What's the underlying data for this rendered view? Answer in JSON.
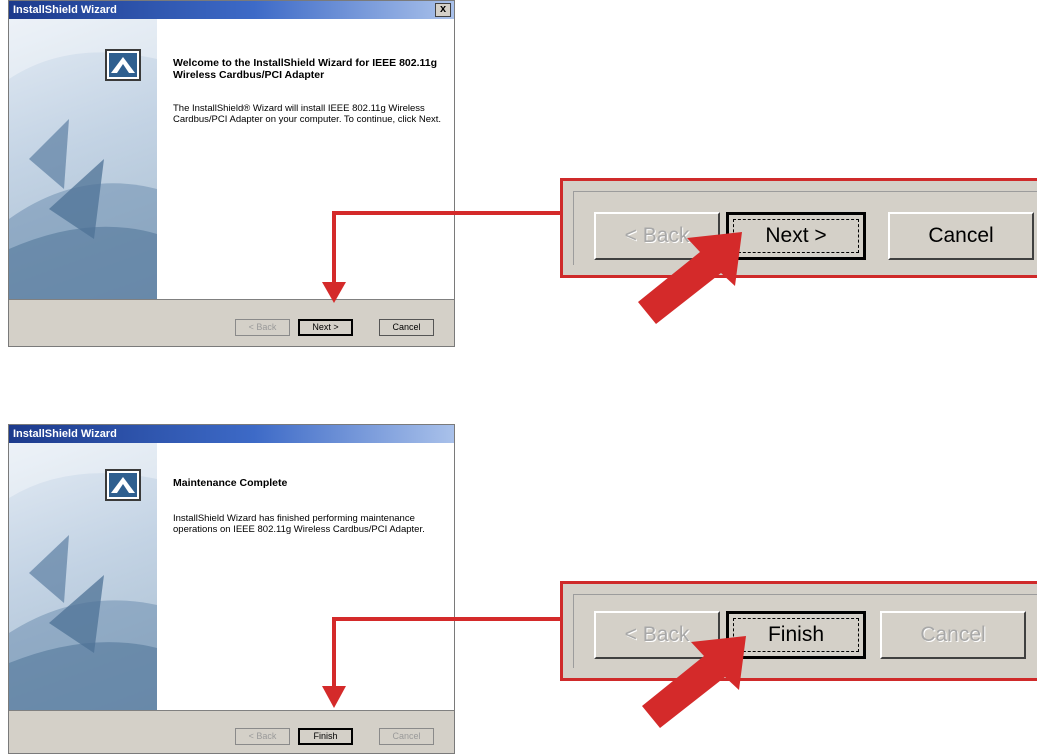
{
  "accent_color": "#cf2a2a",
  "step1": {
    "window_title": "InstallShield Wizard",
    "close_label": "x",
    "heading": "Welcome to the InstallShield Wizard for IEEE 802.11g Wireless Cardbus/PCI Adapter",
    "description": "The InstallShield® Wizard will install IEEE 802.11g Wireless Cardbus/PCI Adapter on your computer. To continue, click Next.",
    "buttons": {
      "back": "< Back",
      "next": "Next >",
      "cancel": "Cancel"
    },
    "zoom_buttons": {
      "back": "< Back",
      "next": "Next >",
      "cancel": "Cancel"
    }
  },
  "step2": {
    "window_title": "InstallShield Wizard",
    "heading": "Maintenance Complete",
    "description": "InstallShield Wizard has finished performing maintenance operations on IEEE 802.11g Wireless Cardbus/PCI Adapter.",
    "buttons": {
      "back": "< Back",
      "finish": "Finish",
      "cancel": "Cancel"
    },
    "zoom_buttons": {
      "back": "< Back",
      "finish": "Finish",
      "cancel": "Cancel"
    }
  }
}
